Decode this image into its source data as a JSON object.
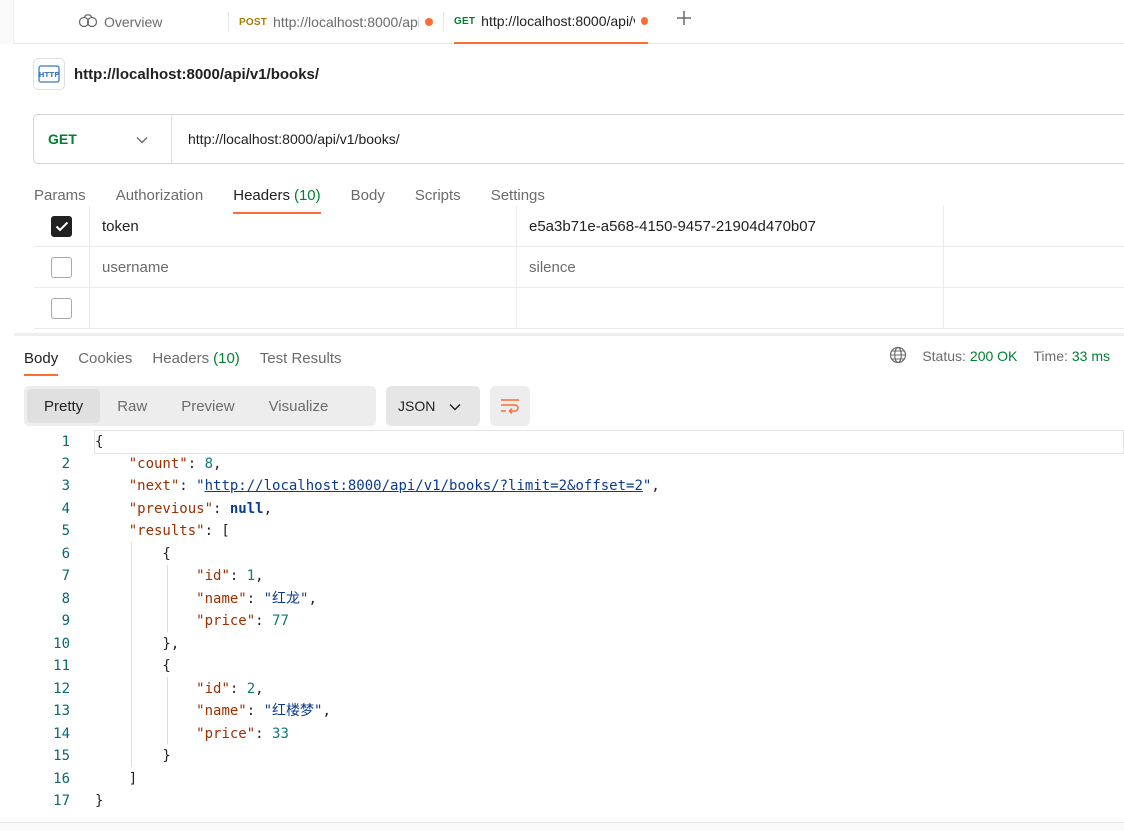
{
  "tabs": {
    "overview": "Overview",
    "post": {
      "method": "POST",
      "label": "http://localhost:8000/api/v1/books/"
    },
    "get": {
      "method": "GET",
      "label": "http://localhost:8000/api/v1/books/"
    }
  },
  "request": {
    "title": "http://localhost:8000/api/v1/books/",
    "method": "GET",
    "url": "http://localhost:8000/api/v1/books/"
  },
  "request_tabs": [
    {
      "label": "Params"
    },
    {
      "label": "Authorization"
    },
    {
      "label": "Headers",
      "count": "(10)"
    },
    {
      "label": "Body"
    },
    {
      "label": "Scripts"
    },
    {
      "label": "Settings"
    }
  ],
  "headers": [
    {
      "checked": true,
      "key": "token",
      "value": "e5a3b71e-a568-4150-9457-21904d470b07"
    },
    {
      "checked": false,
      "key": "username",
      "value": "silence"
    },
    {
      "checked": false,
      "key": "",
      "value": ""
    }
  ],
  "response_tabs": [
    {
      "label": "Body"
    },
    {
      "label": "Cookies"
    },
    {
      "label": "Headers",
      "count": "(10)"
    },
    {
      "label": "Test Results"
    }
  ],
  "status": {
    "status_label": "Status:",
    "status_value": "200 OK",
    "time_label": "Time:",
    "time_value": "33 ms"
  },
  "view_modes": [
    "Pretty",
    "Raw",
    "Preview",
    "Visualize"
  ],
  "format": "JSON",
  "body": {
    "count_key": "\"count\"",
    "count_val": "8",
    "next_key": "\"next\"",
    "next_val": "http://localhost:8000/api/v1/books/?limit=2&offset=2",
    "previous_key": "\"previous\"",
    "previous_val": "null",
    "results_key": "\"results\"",
    "id_key": "\"id\"",
    "name_key": "\"name\"",
    "price_key": "\"price\"",
    "r1_id": "1",
    "r1_name": "\"红龙\"",
    "r1_price": "77",
    "r2_id": "2",
    "r2_name": "\"红楼梦\"",
    "r2_price": "33"
  },
  "colors": {
    "accent": "#ff6c37",
    "get_method": "#007f31",
    "post_method": "#ad7a03"
  }
}
